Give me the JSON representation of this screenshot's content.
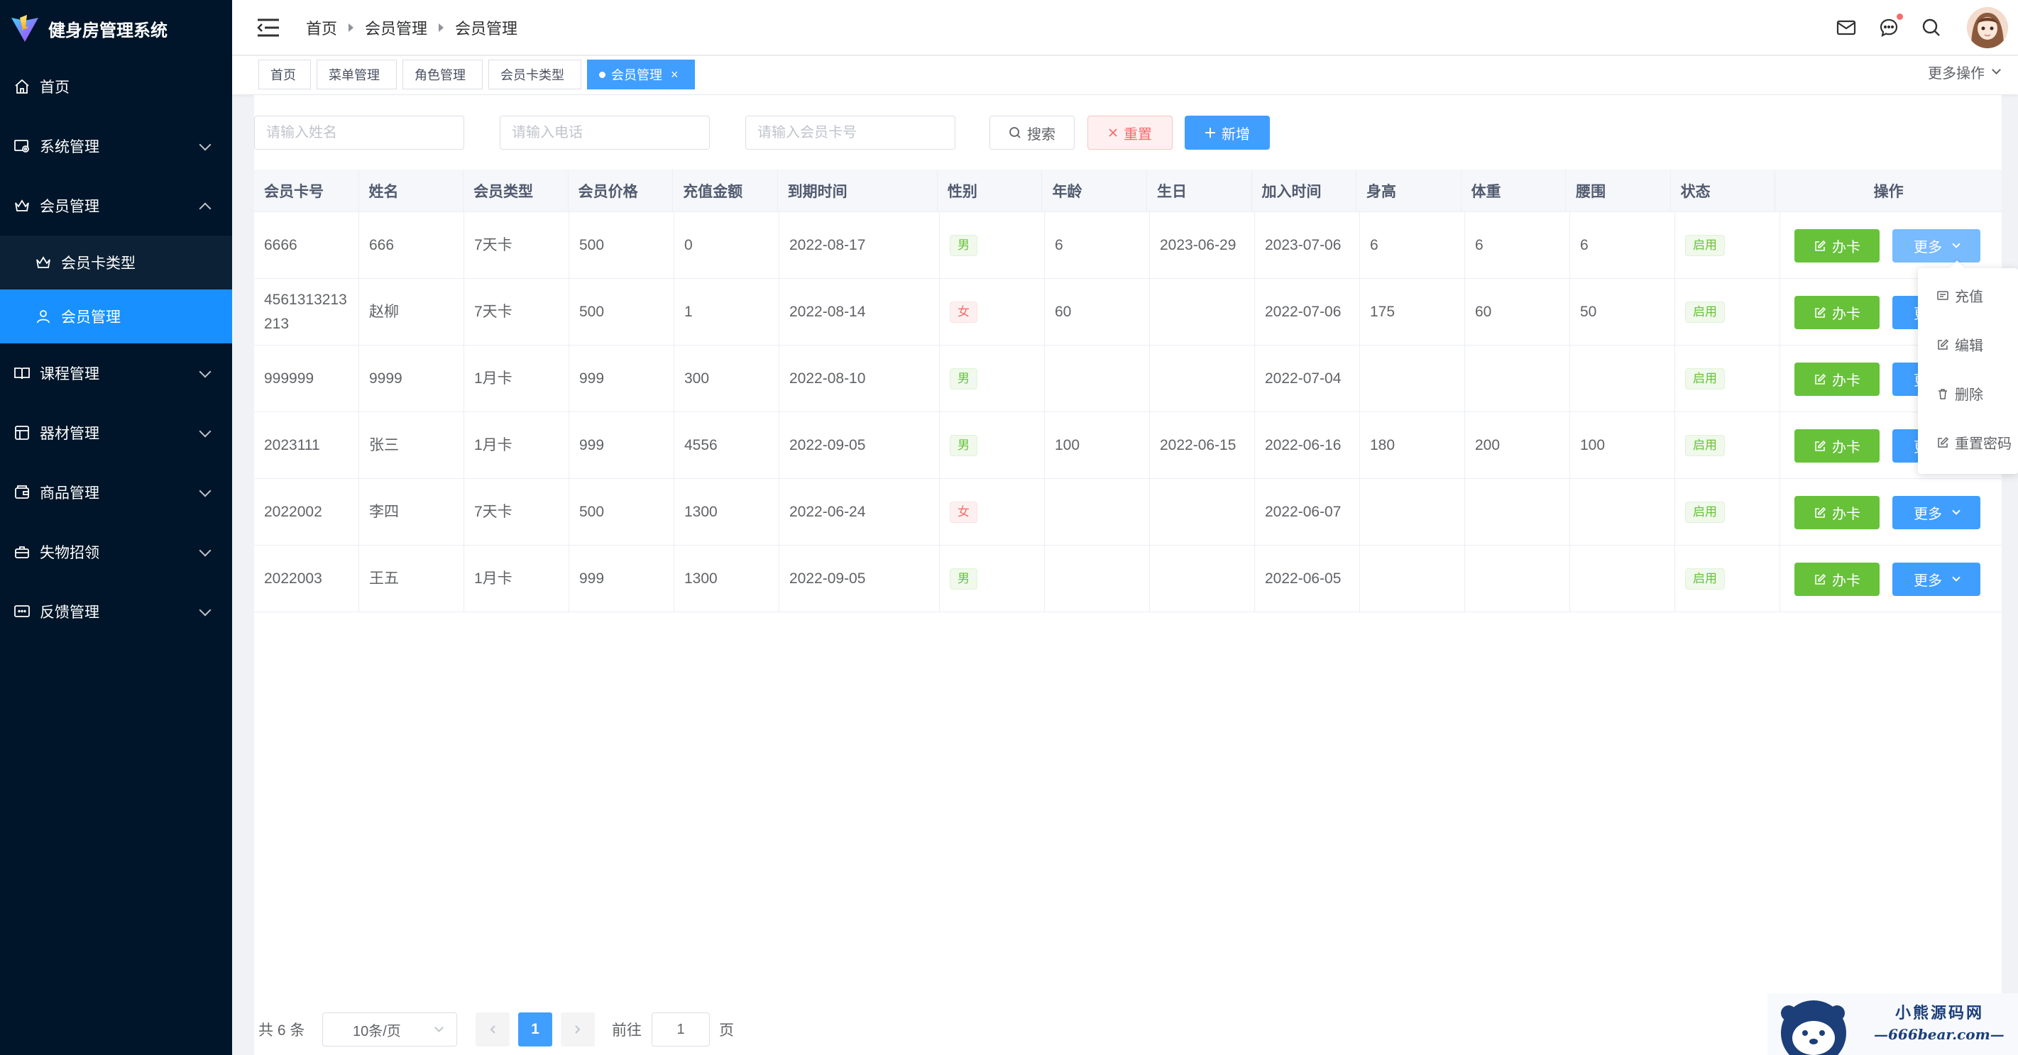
{
  "app": {
    "title": "健身房管理系统"
  },
  "sidebar": {
    "items": [
      {
        "label": "首页"
      },
      {
        "label": "系统管理"
      },
      {
        "label": "会员管理"
      },
      {
        "label": "课程管理"
      },
      {
        "label": "器材管理"
      },
      {
        "label": "商品管理"
      },
      {
        "label": "失物招领"
      },
      {
        "label": "反馈管理"
      }
    ],
    "submenu": [
      {
        "label": "会员卡类型"
      },
      {
        "label": "会员管理"
      }
    ]
  },
  "breadcrumb": [
    "首页",
    "会员管理",
    "会员管理"
  ],
  "tabs": [
    {
      "label": "首页"
    },
    {
      "label": "菜单管理"
    },
    {
      "label": "角色管理"
    },
    {
      "label": "会员卡类型"
    },
    {
      "label": "会员管理",
      "close": "×"
    }
  ],
  "more_ops": "更多操作",
  "search": {
    "name_placeholder": "请输入姓名",
    "phone_placeholder": "请输入电话",
    "card_placeholder": "请输入会员卡号",
    "search_label": "搜索",
    "reset_label": "重置",
    "add_label": "新增"
  },
  "table": {
    "headers": [
      "会员卡号",
      "姓名",
      "会员类型",
      "会员价格",
      "充值金额",
      "到期时间",
      "性别",
      "年龄",
      "生日",
      "加入时间",
      "身高",
      "体重",
      "腰围",
      "状态",
      "操作"
    ],
    "rows": [
      [
        "6666",
        "666",
        "7天卡",
        "500",
        "0",
        "2022-08-17",
        "男",
        "6",
        "2023-06-29",
        "2023-07-06",
        "6",
        "6",
        "6",
        "启用"
      ],
      [
        "4561313213213",
        "赵柳",
        "7天卡",
        "500",
        "1",
        "2022-08-14",
        "女",
        "60",
        "",
        "2022-07-06",
        "175",
        "60",
        "50",
        "启用"
      ],
      [
        "999999",
        "9999",
        "1月卡",
        "999",
        "300",
        "2022-08-10",
        "男",
        "",
        "",
        "2022-07-04",
        "",
        "",
        "",
        "启用"
      ],
      [
        "2023111",
        "张三",
        "1月卡",
        "999",
        "4556",
        "2022-09-05",
        "男",
        "100",
        "2022-06-15",
        "2022-06-16",
        "180",
        "200",
        "100",
        "启用"
      ],
      [
        "2022002",
        "李四",
        "7天卡",
        "500",
        "1300",
        "2022-06-24",
        "女",
        "",
        "",
        "2022-06-07",
        "",
        "",
        "",
        "启用"
      ],
      [
        "2022003",
        "王五",
        "1月卡",
        "999",
        "1300",
        "2022-09-05",
        "男",
        "",
        "",
        "2022-06-05",
        "",
        "",
        "",
        "启用"
      ]
    ],
    "card_btn": "办卡",
    "more_btn": "更多"
  },
  "dropdown": [
    "充值",
    "编辑",
    "删除",
    "重置密码"
  ],
  "pagination": {
    "total": "共 6 条",
    "page_size": "10条/页",
    "current": "1",
    "goto_label": "前往",
    "goto_value": "1",
    "page_label": "页"
  },
  "watermark": {
    "line1": "小熊源码网",
    "line2": "—666bear.com—"
  },
  "colors": {
    "sidebar_bg": "#001529",
    "primary": "#409eff",
    "active_menu": "#1890ff",
    "success": "#67c23a",
    "danger": "#f56c6c"
  }
}
